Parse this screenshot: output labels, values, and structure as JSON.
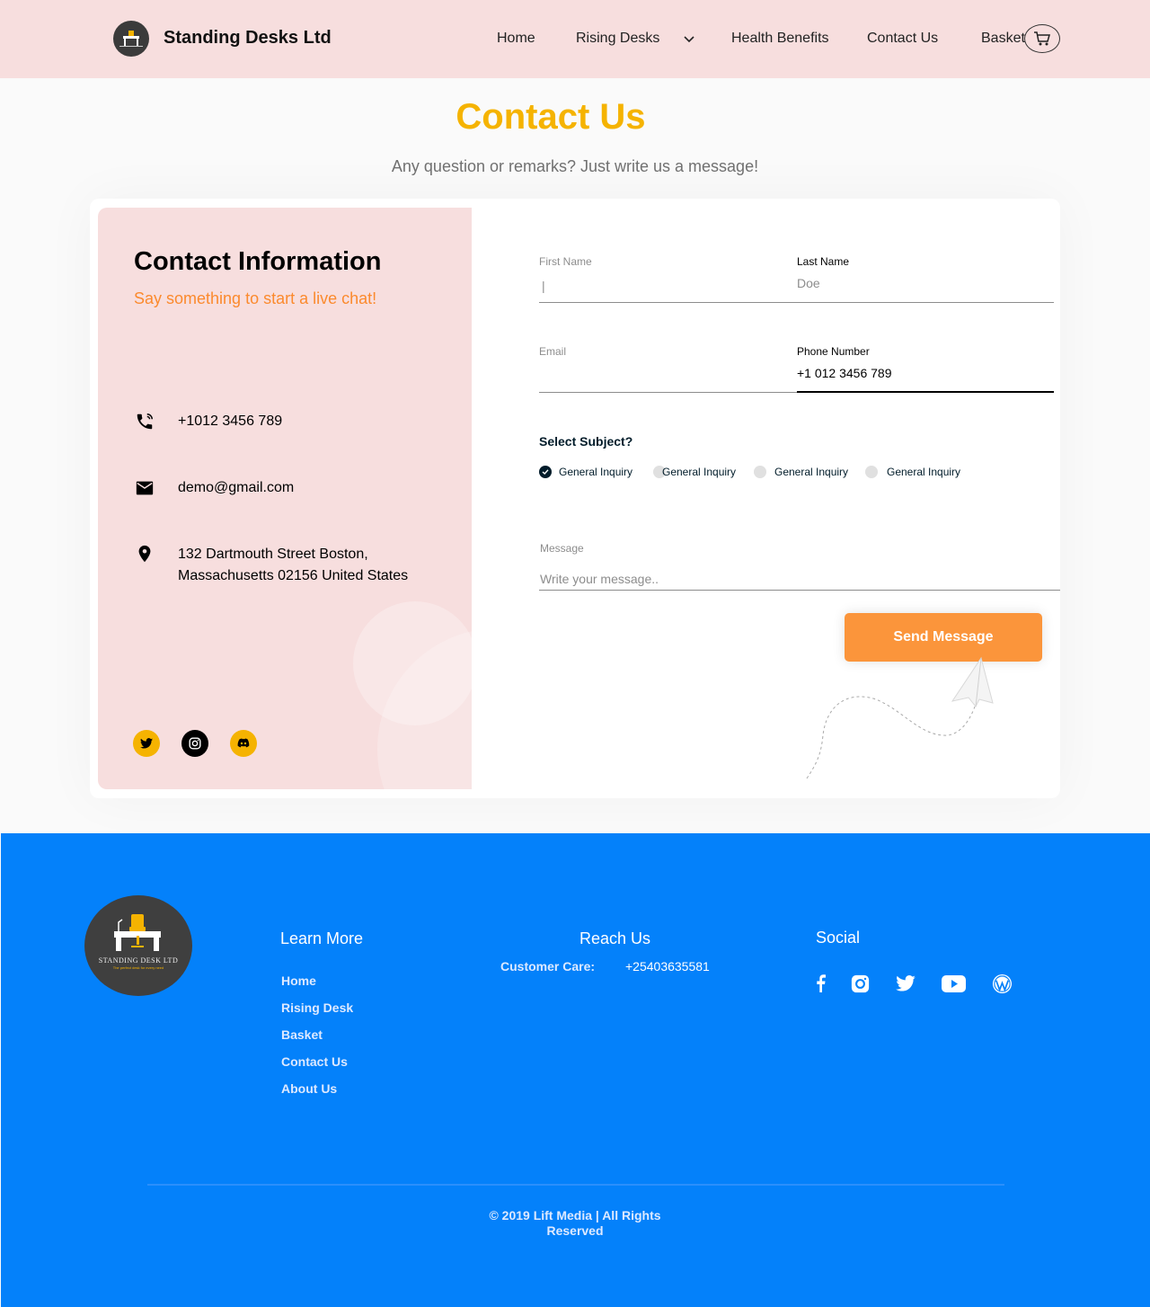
{
  "nav": {
    "brand": "Standing Desks Ltd",
    "links": [
      "Home",
      "Rising Desks",
      "Health Benefits",
      "Contact Us",
      "Basket"
    ]
  },
  "header": {
    "title": "Contact Us",
    "subtitle": "Any question or remarks? Just write us a message!"
  },
  "contact_info": {
    "title": "Contact Information",
    "subtitle": "Say something to start a live chat!",
    "phone": "+1012 3456 789",
    "email": "demo@gmail.com",
    "address_line1": "132 Dartmouth Street Boston,",
    "address_line2": "Massachusetts 02156 United States",
    "social": [
      "twitter-icon",
      "instagram-icon",
      "discord-icon"
    ]
  },
  "form": {
    "first_name_label": "First Name",
    "first_name_value": "|",
    "last_name_label": "Last Name",
    "last_name_placeholder": "Doe",
    "email_label": "Email",
    "phone_label": "Phone Number",
    "phone_value": "+1 012 3456 789",
    "subject_title": "Select Subject?",
    "subjects": [
      "General Inquiry",
      "General Inquiry",
      "General Inquiry",
      "General Inquiry"
    ],
    "selected_subject_index": 0,
    "message_label": "Message",
    "message_placeholder": "Write your message..",
    "send_label": "Send Message"
  },
  "footer": {
    "logo_text": "STANDING DESK LTD",
    "logo_tagline": "The perfect desk for every need",
    "learn_more_title": "Learn More",
    "learn_more_links": [
      "Home",
      "Rising Desk",
      "Basket",
      "Contact Us",
      "About Us"
    ],
    "reach_title": "Reach Us",
    "care_label": "Customer Care:",
    "care_phone": "+25403635581",
    "social_title": "Social",
    "social_icons": [
      "facebook-icon",
      "instagram-icon",
      "twitter-icon",
      "youtube-icon",
      "wordpress-icon"
    ],
    "copyright_line1": "© 2019 Lift Media | All Rights",
    "copyright_line2": "Reserved"
  },
  "colors": {
    "nav_bg": "#f7dede",
    "title_yellow": "#f5b301",
    "accent_orange": "#fb953b",
    "footer_blue": "#0481fa"
  }
}
